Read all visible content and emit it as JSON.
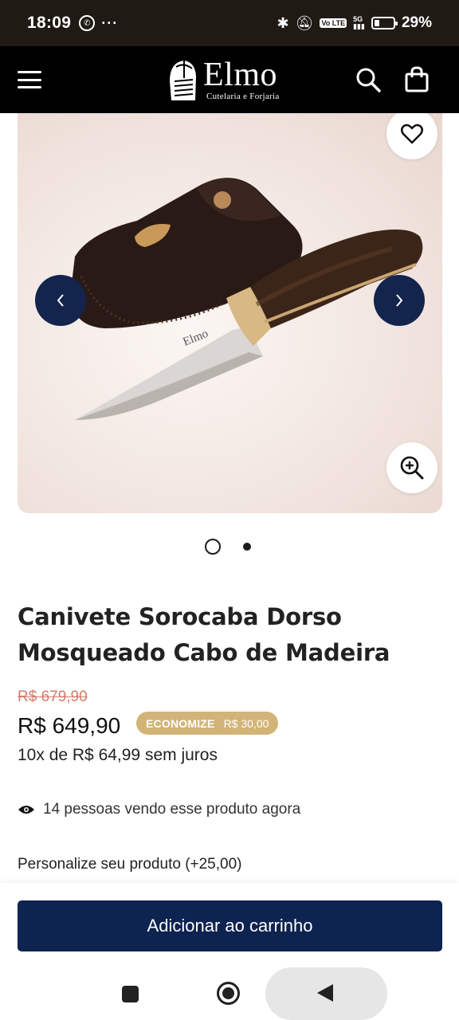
{
  "status_bar": {
    "time": "18:09",
    "more": "···",
    "network": "5G",
    "volte": "Vo LTE",
    "battery_percent": "29%",
    "battery_level": 0.29
  },
  "header": {
    "logo_name": "Elmo",
    "logo_tagline": "Cutelaria e Forjaria"
  },
  "gallery": {
    "current_slide": 1,
    "total_slides": 2,
    "blade_engraving": "Elmo"
  },
  "product": {
    "title": "Canivete Sorocaba Dorso Mosqueado Cabo de Madeira",
    "old_price": "R$ 679,90",
    "price": "R$ 649,90",
    "badge_label": "ECONOMIZE",
    "badge_value": "R$ 30,00",
    "installments": "10x de R$ 64,99 sem juros",
    "viewers": "14 pessoas vendo esse produto agora",
    "personalize": "Personalize seu produto (+25,00)"
  },
  "cart": {
    "button_label": "Adicionar ao carrinho"
  },
  "colors": {
    "header_bg": "#000000",
    "accent_navy": "#0d2350",
    "badge_gold": "#d3b478",
    "old_price": "#d57a6a"
  },
  "icons": [
    "menu-icon",
    "search-icon",
    "shopping-bag-icon",
    "heart-icon",
    "zoom-in-icon",
    "chevron-left-icon",
    "chevron-right-icon",
    "eye-icon"
  ]
}
